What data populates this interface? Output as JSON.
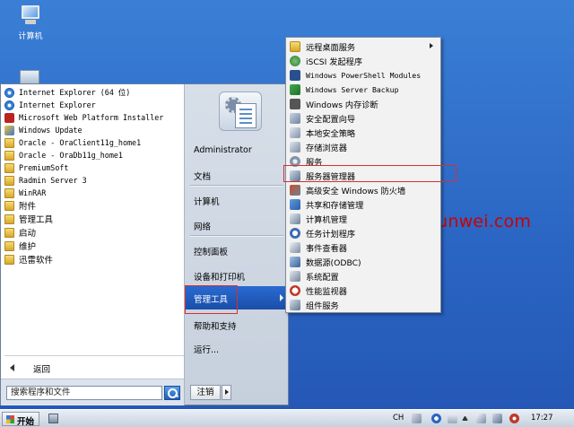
{
  "desktop": {
    "icons": [
      {
        "label": "计算机",
        "icon": "computer-icon"
      },
      {
        "label": "",
        "icon": "recycle-bin-icon"
      }
    ],
    "watermark": "www.osyunwei.com"
  },
  "start_menu": {
    "programs": [
      {
        "label": "Internet Explorer (64 位)",
        "icon": "internet-explorer-icon"
      },
      {
        "label": "Internet Explorer",
        "icon": "internet-explorer-icon"
      },
      {
        "label": "Microsoft Web Platform Installer",
        "icon": "web-platform-icon"
      },
      {
        "label": "Windows Update",
        "icon": "windows-update-icon"
      },
      {
        "label": "Oracle - OraClient11g_home1",
        "icon": "folder-icon"
      },
      {
        "label": "Oracle - OraDb11g_home1",
        "icon": "folder-icon"
      },
      {
        "label": "PremiumSoft",
        "icon": "folder-icon"
      },
      {
        "label": "Radmin Server 3",
        "icon": "folder-icon"
      },
      {
        "label": "WinRAR",
        "icon": "folder-icon"
      },
      {
        "label": "附件",
        "icon": "folder-icon"
      },
      {
        "label": "管理工具",
        "icon": "folder-icon"
      },
      {
        "label": "启动",
        "icon": "folder-icon"
      },
      {
        "label": "维护",
        "icon": "folder-icon"
      },
      {
        "label": "迅雷软件",
        "icon": "folder-icon"
      }
    ],
    "back_label": "返回",
    "search_placeholder": "搜索程序和文件",
    "right_items": {
      "user": "Administrator",
      "documents": "文档",
      "computer": "计算机",
      "network": "网络",
      "control_panel": "控制面板",
      "devices": "设备和打印机",
      "admin_tools": "管理工具",
      "help": "帮助和支持",
      "run": "运行..."
    },
    "logoff_label": "注销"
  },
  "submenu": {
    "items": [
      {
        "label": "远程桌面服务",
        "icon": "folder-icon",
        "has_sub": true,
        "mono": false
      },
      {
        "label": "iSCSI 发起程序",
        "icon": "iscsi-icon",
        "has_sub": false,
        "mono": false
      },
      {
        "label": "Windows PowerShell Modules",
        "icon": "powershell-icon",
        "has_sub": false,
        "mono": true
      },
      {
        "label": "Windows Server Backup",
        "icon": "backup-icon",
        "has_sub": false,
        "mono": true
      },
      {
        "label": "Windows 内存诊断",
        "icon": "memory-diagnostic-icon",
        "has_sub": false,
        "mono": false
      },
      {
        "label": "安全配置向导",
        "icon": "security-wizard-icon",
        "has_sub": false,
        "mono": false
      },
      {
        "label": "本地安全策略",
        "icon": "security-policy-icon",
        "has_sub": false,
        "mono": false
      },
      {
        "label": "存储浏览器",
        "icon": "storage-explorer-icon",
        "has_sub": false,
        "mono": false
      },
      {
        "label": "服务",
        "icon": "services-icon",
        "has_sub": false,
        "mono": false
      },
      {
        "label": "服务器管理器",
        "icon": "server-manager-icon",
        "has_sub": false,
        "mono": false
      },
      {
        "label": "高级安全 Windows 防火墙",
        "icon": "firewall-icon",
        "has_sub": false,
        "mono": false
      },
      {
        "label": "共享和存储管理",
        "icon": "share-storage-icon",
        "has_sub": false,
        "mono": false
      },
      {
        "label": "计算机管理",
        "icon": "computer-management-icon",
        "has_sub": false,
        "mono": false
      },
      {
        "label": "任务计划程序",
        "icon": "task-scheduler-icon",
        "has_sub": false,
        "mono": false
      },
      {
        "label": "事件查看器",
        "icon": "event-viewer-icon",
        "has_sub": false,
        "mono": false
      },
      {
        "label": "数据源(ODBC)",
        "icon": "odbc-icon",
        "has_sub": false,
        "mono": false
      },
      {
        "label": "系统配置",
        "icon": "system-config-icon",
        "has_sub": false,
        "mono": false
      },
      {
        "label": "性能监视器",
        "icon": "performance-monitor-icon",
        "has_sub": false,
        "mono": false
      },
      {
        "label": "组件服务",
        "icon": "component-services-icon",
        "has_sub": false,
        "mono": false
      }
    ]
  },
  "taskbar": {
    "start_label": "开始",
    "language": "CH",
    "clock": "17:27"
  },
  "colors": {
    "desktop": "#2a64c2",
    "highlight": "#1a4ea8",
    "annotation_red": "#d63030",
    "watermark": "#cc0000"
  }
}
